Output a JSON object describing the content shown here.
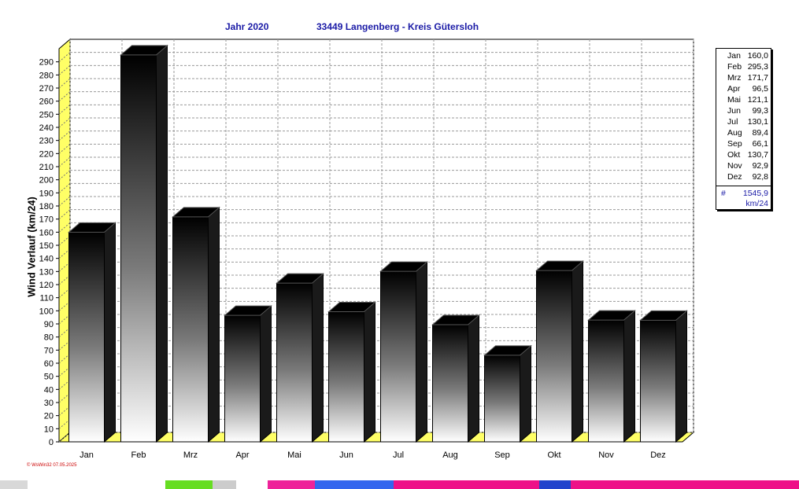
{
  "header": {
    "title_year": "Jahr  2020",
    "title_location": "33449 Langenberg - Kreis Gütersloh"
  },
  "chart_data": {
    "type": "bar",
    "ylabel": "Wind Verlauf  (km/24)",
    "ylim": [
      0,
      300
    ],
    "yticks": [
      0,
      10,
      20,
      30,
      40,
      50,
      60,
      70,
      80,
      90,
      100,
      110,
      120,
      130,
      140,
      150,
      160,
      170,
      180,
      190,
      200,
      210,
      220,
      230,
      240,
      250,
      260,
      270,
      280,
      290
    ],
    "categories": [
      "Jan",
      "Feb",
      "Mrz",
      "Apr",
      "Mai",
      "Jun",
      "Jul",
      "Aug",
      "Sep",
      "Okt",
      "Nov",
      "Dez"
    ],
    "values": [
      160.0,
      295.3,
      171.7,
      96.5,
      121.1,
      99.3,
      130.1,
      89.4,
      66.1,
      130.7,
      92.9,
      92.8
    ],
    "grid": true,
    "legend_position": "right"
  },
  "legend": {
    "items": [
      {
        "month": "Jan",
        "value": "160,0"
      },
      {
        "month": "Feb",
        "value": "295,3"
      },
      {
        "month": "Mrz",
        "value": "171,7"
      },
      {
        "month": "Apr",
        "value": "96,5"
      },
      {
        "month": "Mai",
        "value": "121,1"
      },
      {
        "month": "Jun",
        "value": "99,3"
      },
      {
        "month": "Jul",
        "value": "130,1"
      },
      {
        "month": "Aug",
        "value": "89,4"
      },
      {
        "month": "Sep",
        "value": "66,1"
      },
      {
        "month": "Okt",
        "value": "130,7"
      },
      {
        "month": "Nov",
        "value": "92,9"
      },
      {
        "month": "Dez",
        "value": "92,8"
      }
    ],
    "total_symbol": "#",
    "total": "1545,9",
    "unit": "km/24"
  },
  "footer": {
    "credit": "© WsWin32  07.05.2025"
  },
  "colors": {
    "title": "#1a1aa6",
    "axis_wall": "#ffff66",
    "grid": "#999999",
    "bar_top": "#000000",
    "bar_bottom": "#ffffff",
    "footer": "#cc0000"
  }
}
